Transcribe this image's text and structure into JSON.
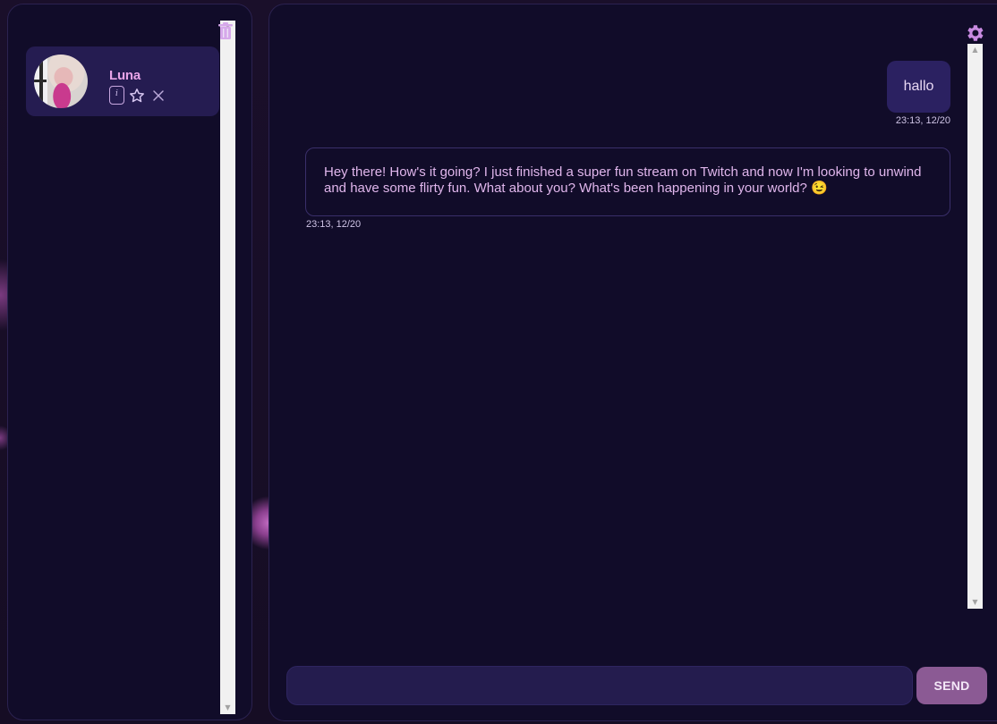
{
  "sidebar": {
    "contacts": [
      {
        "name": "Luna",
        "info_label": "i"
      }
    ]
  },
  "chat": {
    "messages": [
      {
        "role": "user",
        "text": "hallo",
        "time": "23:13, 12/20"
      },
      {
        "role": "bot",
        "text": "Hey there! How's it going? I just finished a super fun stream on Twitch and now I'm looking to unwind and have some flirty fun. What about you? What's been happening in your world? 😉",
        "time": "23:13, 12/20"
      }
    ],
    "input": {
      "value": "",
      "placeholder": ""
    },
    "send_label": "SEND"
  },
  "icons": {
    "trash": "trash-icon",
    "settings": "gear-icon",
    "favorite": "star-icon",
    "remove": "close-icon",
    "info": "info-icon"
  },
  "colors": {
    "accent": "#8b5a94",
    "name": "#e8a4e8",
    "panel": "#110c29",
    "card": "#251c51",
    "user_bubble": "#2b2161"
  }
}
